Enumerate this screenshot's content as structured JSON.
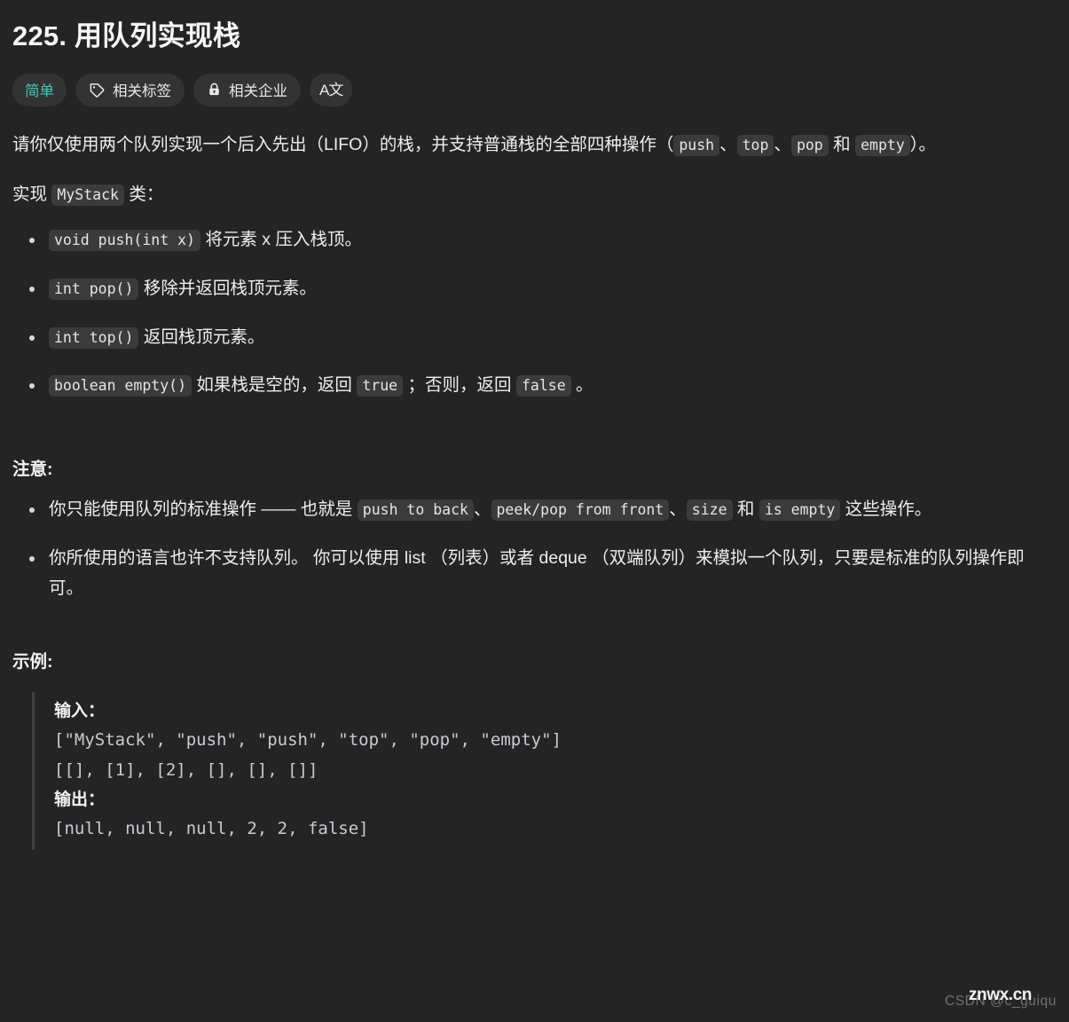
{
  "problem": {
    "number": "225.",
    "title": "用队列实现栈",
    "full_title": "225. 用队列实现栈"
  },
  "tags": {
    "difficulty": "简单",
    "related_tags": "相关标签",
    "related_companies": "相关企业",
    "translate_glyph": "A文",
    "icons": {
      "tag": "tag-icon",
      "lock": "lock-icon",
      "translate": "translate-icon"
    }
  },
  "description": {
    "p1_a": "请你仅使用两个队列实现一个后入先出（LIFO）的栈，并支持普通栈的全部四种操作（",
    "p1_code1": "push",
    "p1_b": "、",
    "p1_code2": "top",
    "p1_c": "、",
    "p1_code3": "pop",
    "p1_d": " 和 ",
    "p1_code4": "empty",
    "p1_e": "）。",
    "p2_a": "实现 ",
    "p2_code": "MyStack",
    "p2_b": " 类：",
    "methods": [
      {
        "code": "void push(int x)",
        "text": " 将元素 x 压入栈顶。"
      },
      {
        "code": "int pop()",
        "text": " 移除并返回栈顶元素。"
      },
      {
        "code": "int top()",
        "text": " 返回栈顶元素。"
      }
    ],
    "method4": {
      "code": "boolean empty()",
      "text_a": " 如果栈是空的，返回 ",
      "code_true": "true",
      "text_b": " ；否则，返回 ",
      "code_false": "false",
      "text_c": " 。"
    }
  },
  "notes": {
    "heading": "注意:",
    "item1": {
      "a": "你只能使用队列的标准操作 —— 也就是 ",
      "code1": "push to back",
      "b": "、",
      "code2": "peek/pop from front",
      "c": "、",
      "code3": "size",
      "d": " 和 ",
      "code4": "is empty",
      "e": " 这些操作。"
    },
    "item2": "你所使用的语言也许不支持队列。 你可以使用 list （列表）或者 deque （双端队列）来模拟一个队列，只要是标准的队列操作即可。"
  },
  "example": {
    "heading": "示例:",
    "input_label": "输入：",
    "input_lines": "[\"MyStack\", \"push\", \"push\", \"top\", \"pop\", \"empty\"]\n[[], [1], [2], [], [], []]",
    "output_label": "输出：",
    "output_lines": "[null, null, null, 2, 2, false]"
  },
  "watermark": {
    "front": "znwx.cn",
    "back": "CSDN @c_guiqu"
  },
  "colors": {
    "page_background": "#242424",
    "text": "#eceef1",
    "chip_background": "#333333",
    "difficulty_accent": "#46c7b8",
    "code_background": "#3b3b3b",
    "blockquote_border": "#3f3f3f"
  }
}
